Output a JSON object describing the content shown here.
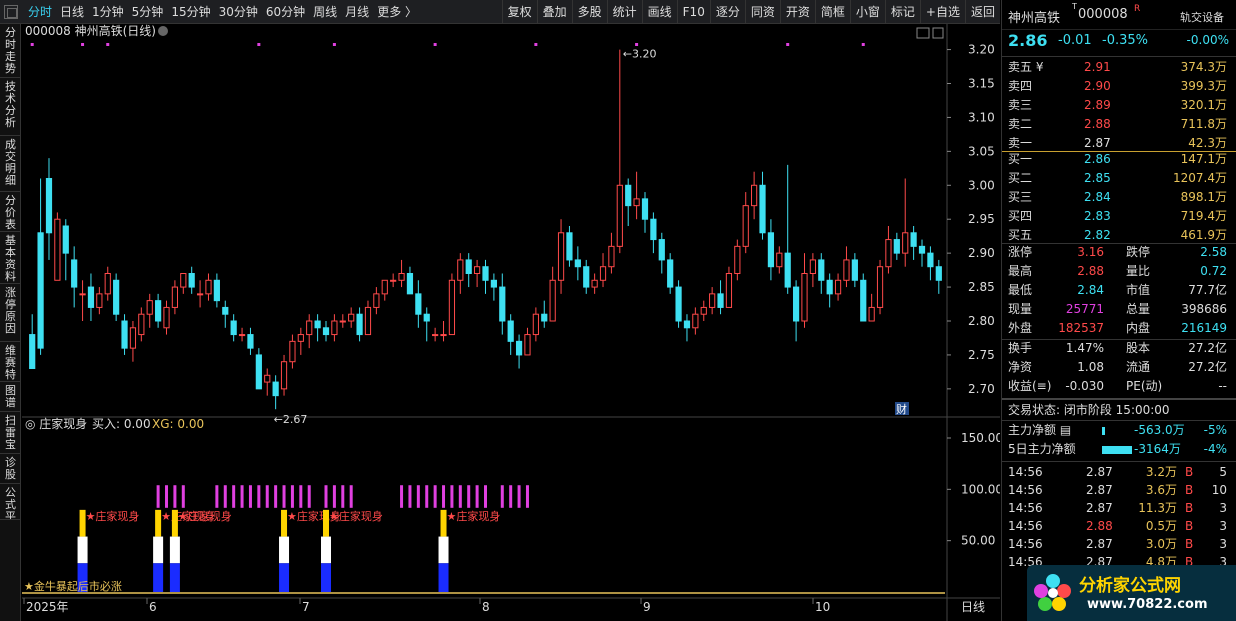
{
  "toolbar": {
    "tabs": [
      "分时",
      "日线",
      "1分钟",
      "5分钟",
      "15分钟",
      "30分钟",
      "60分钟",
      "周线",
      "月线",
      "更多 〉"
    ],
    "tools": [
      "复权",
      "叠加",
      "多股",
      "统计",
      "画线",
      "F10",
      "逐分",
      "同资",
      "开资",
      "简框",
      "小窗",
      "标记",
      "+自选",
      "返回"
    ]
  },
  "leftnav": [
    "分时走势",
    "技术分析",
    "成交明细",
    "分价表",
    "基本资料",
    "涨停原因",
    "维赛特",
    "图谱",
    "扫雷宝",
    "诊股",
    "公式平台"
  ],
  "chart": {
    "title": "000008 神州高铁(日线)",
    "price_axis": [
      "3.20",
      "3.15",
      "3.10",
      "3.05",
      "3.00",
      "2.95",
      "2.90",
      "2.85",
      "2.80",
      "2.75",
      "2.70"
    ],
    "high_label": "3.20",
    "low_label": "2.67",
    "cai_badge": "财",
    "indicator_title": "庄家现身",
    "indicator_buy": "买入: 0.00",
    "indicator_xg": "XG: 0.00",
    "ind_axis": [
      "150.00",
      "100.00",
      "50.00"
    ],
    "signal_label": "★庄家现身",
    "bottom_note": "★金牛暴起后市必涨",
    "x_labels": [
      "2025年",
      "6",
      "7",
      "8",
      "9",
      "10"
    ],
    "period": "日线"
  },
  "chart_data": {
    "type": "candlestick",
    "ylim": [
      2.66,
      3.22
    ],
    "candles": [
      [
        2.78,
        2.73,
        2.73,
        2.81
      ],
      [
        2.93,
        2.76,
        2.75,
        3.01
      ],
      [
        3.01,
        2.93,
        2.89,
        3.04
      ],
      [
        2.86,
        2.95,
        2.86,
        2.96
      ],
      [
        2.94,
        2.9,
        2.86,
        2.95
      ],
      [
        2.89,
        2.85,
        2.82,
        2.91
      ],
      [
        2.84,
        2.84,
        2.8,
        2.86
      ],
      [
        2.85,
        2.82,
        2.8,
        2.87
      ],
      [
        2.82,
        2.84,
        2.81,
        2.85
      ],
      [
        2.84,
        2.87,
        2.83,
        2.88
      ],
      [
        2.86,
        2.81,
        2.8,
        2.87
      ],
      [
        2.8,
        2.76,
        2.75,
        2.81
      ],
      [
        2.76,
        2.79,
        2.74,
        2.8
      ],
      [
        2.78,
        2.81,
        2.77,
        2.82
      ],
      [
        2.81,
        2.83,
        2.79,
        2.84
      ],
      [
        2.83,
        2.8,
        2.79,
        2.84
      ],
      [
        2.79,
        2.82,
        2.78,
        2.83
      ],
      [
        2.82,
        2.85,
        2.81,
        2.86
      ],
      [
        2.85,
        2.87,
        2.84,
        2.87
      ],
      [
        2.87,
        2.85,
        2.84,
        2.88
      ],
      [
        2.84,
        2.84,
        2.82,
        2.86
      ],
      [
        2.84,
        2.86,
        2.83,
        2.87
      ],
      [
        2.86,
        2.83,
        2.82,
        2.87
      ],
      [
        2.82,
        2.81,
        2.79,
        2.83
      ],
      [
        2.8,
        2.78,
        2.77,
        2.81
      ],
      [
        2.78,
        2.78,
        2.77,
        2.79
      ],
      [
        2.78,
        2.76,
        2.75,
        2.79
      ],
      [
        2.75,
        2.7,
        2.7,
        2.76
      ],
      [
        2.71,
        2.72,
        2.69,
        2.73
      ],
      [
        2.71,
        2.69,
        2.67,
        2.72
      ],
      [
        2.7,
        2.74,
        2.69,
        2.75
      ],
      [
        2.74,
        2.77,
        2.73,
        2.78
      ],
      [
        2.77,
        2.78,
        2.75,
        2.79
      ],
      [
        2.78,
        2.8,
        2.76,
        2.81
      ],
      [
        2.8,
        2.79,
        2.77,
        2.81
      ],
      [
        2.79,
        2.78,
        2.77,
        2.8
      ],
      [
        2.78,
        2.8,
        2.77,
        2.81
      ],
      [
        2.8,
        2.8,
        2.79,
        2.81
      ],
      [
        2.8,
        2.81,
        2.79,
        2.82
      ],
      [
        2.81,
        2.78,
        2.77,
        2.82
      ],
      [
        2.78,
        2.82,
        2.78,
        2.83
      ],
      [
        2.82,
        2.84,
        2.81,
        2.85
      ],
      [
        2.84,
        2.86,
        2.83,
        2.86
      ],
      [
        2.86,
        2.86,
        2.85,
        2.87
      ],
      [
        2.86,
        2.87,
        2.85,
        2.89
      ],
      [
        2.87,
        2.84,
        2.84,
        2.88
      ],
      [
        2.84,
        2.81,
        2.79,
        2.86
      ],
      [
        2.81,
        2.8,
        2.77,
        2.82
      ],
      [
        2.78,
        2.78,
        2.77,
        2.79
      ],
      [
        2.78,
        2.78,
        2.77,
        2.8
      ],
      [
        2.78,
        2.86,
        2.78,
        2.87
      ],
      [
        2.86,
        2.89,
        2.84,
        2.9
      ],
      [
        2.89,
        2.87,
        2.85,
        2.9
      ],
      [
        2.87,
        2.88,
        2.85,
        2.89
      ],
      [
        2.88,
        2.86,
        2.84,
        2.89
      ],
      [
        2.86,
        2.85,
        2.83,
        2.87
      ],
      [
        2.85,
        2.8,
        2.78,
        2.87
      ],
      [
        2.8,
        2.77,
        2.75,
        2.81
      ],
      [
        2.77,
        2.75,
        2.73,
        2.78
      ],
      [
        2.75,
        2.78,
        2.75,
        2.79
      ],
      [
        2.78,
        2.81,
        2.77,
        2.82
      ],
      [
        2.81,
        2.8,
        2.79,
        2.83
      ],
      [
        2.8,
        2.86,
        2.8,
        2.88
      ],
      [
        2.86,
        2.93,
        2.84,
        2.95
      ],
      [
        2.93,
        2.89,
        2.88,
        2.94
      ],
      [
        2.89,
        2.88,
        2.86,
        2.91
      ],
      [
        2.88,
        2.85,
        2.84,
        2.89
      ],
      [
        2.85,
        2.86,
        2.84,
        2.87
      ],
      [
        2.86,
        2.88,
        2.85,
        2.9
      ],
      [
        2.88,
        2.91,
        2.87,
        2.93
      ],
      [
        2.91,
        3.0,
        2.9,
        3.2
      ],
      [
        3.0,
        2.97,
        2.94,
        3.01
      ],
      [
        2.97,
        2.98,
        2.95,
        3.02
      ],
      [
        2.98,
        2.95,
        2.93,
        2.99
      ],
      [
        2.95,
        2.92,
        2.9,
        2.96
      ],
      [
        2.92,
        2.89,
        2.87,
        2.93
      ],
      [
        2.89,
        2.85,
        2.84,
        2.9
      ],
      [
        2.85,
        2.8,
        2.79,
        2.86
      ],
      [
        2.8,
        2.79,
        2.77,
        2.81
      ],
      [
        2.79,
        2.81,
        2.78,
        2.82
      ],
      [
        2.81,
        2.82,
        2.8,
        2.83
      ],
      [
        2.82,
        2.84,
        2.81,
        2.85
      ],
      [
        2.84,
        2.82,
        2.81,
        2.86
      ],
      [
        2.82,
        2.87,
        2.82,
        2.88
      ],
      [
        2.87,
        2.91,
        2.86,
        2.92
      ],
      [
        2.91,
        2.97,
        2.9,
        2.99
      ],
      [
        2.97,
        3.0,
        2.95,
        3.02
      ],
      [
        3.0,
        2.93,
        2.92,
        3.02
      ],
      [
        2.93,
        2.88,
        2.86,
        2.95
      ],
      [
        2.88,
        2.9,
        2.87,
        2.91
      ],
      [
        2.9,
        2.85,
        2.84,
        3.03
      ],
      [
        2.85,
        2.8,
        2.77,
        2.86
      ],
      [
        2.8,
        2.87,
        2.79,
        2.9
      ],
      [
        2.87,
        2.89,
        2.85,
        2.9
      ],
      [
        2.89,
        2.86,
        2.84,
        2.9
      ],
      [
        2.86,
        2.84,
        2.82,
        2.87
      ],
      [
        2.84,
        2.86,
        2.83,
        2.87
      ],
      [
        2.86,
        2.89,
        2.85,
        2.91
      ],
      [
        2.89,
        2.86,
        2.85,
        2.9
      ],
      [
        2.86,
        2.8,
        2.8,
        2.87
      ],
      [
        2.8,
        2.82,
        2.8,
        2.84
      ],
      [
        2.82,
        2.88,
        2.81,
        2.89
      ],
      [
        2.88,
        2.92,
        2.87,
        2.94
      ],
      [
        2.92,
        2.9,
        2.89,
        2.93
      ],
      [
        2.9,
        2.93,
        2.88,
        3.01
      ],
      [
        2.93,
        2.91,
        2.89,
        2.94
      ],
      [
        2.91,
        2.9,
        2.88,
        2.92
      ],
      [
        2.9,
        2.88,
        2.86,
        2.91
      ],
      [
        2.88,
        2.86,
        2.84,
        2.89
      ]
    ],
    "signals": [
      {
        "idx": 6
      },
      {
        "idx": 15
      },
      {
        "idx": 17
      },
      {
        "idx": 30
      },
      {
        "idx": 35
      },
      {
        "idx": 49
      }
    ],
    "pink_groups": [
      [
        15,
        18
      ],
      [
        22,
        33
      ],
      [
        35,
        38
      ],
      [
        44,
        54
      ],
      [
        56,
        59
      ]
    ]
  },
  "quote": {
    "name": "神州高铁",
    "code": "000008",
    "badge": "R",
    "price": "2.86",
    "change": "-0.01",
    "pct": "-0.35%",
    "link_label": "轨交设备",
    "link_pct": "-0.00%",
    "asks": [
      [
        "卖五 ¥",
        "2.91",
        "374.3万"
      ],
      [
        "卖四",
        "2.90",
        "399.3万"
      ],
      [
        "卖三",
        "2.89",
        "320.1万"
      ],
      [
        "卖二",
        "2.88",
        "711.8万"
      ],
      [
        "卖一",
        "2.87",
        "42.3万"
      ]
    ],
    "bids": [
      [
        "买一",
        "2.86",
        "147.1万"
      ],
      [
        "买二",
        "2.85",
        "1207.4万"
      ],
      [
        "买三",
        "2.84",
        "898.1万"
      ],
      [
        "买四",
        "2.83",
        "719.4万"
      ],
      [
        "买五",
        "2.82",
        "461.9万"
      ]
    ],
    "stats": [
      [
        "涨停",
        "3.16",
        "跌停",
        "2.58"
      ],
      [
        "最高",
        "2.88",
        "量比",
        "0.72"
      ],
      [
        "最低",
        "2.84",
        "市值",
        "77.7亿"
      ],
      [
        "现量",
        "25771",
        "总量",
        "398686"
      ],
      [
        "外盘",
        "182537",
        "内盘",
        "216149"
      ]
    ],
    "stats2": [
      [
        "换手",
        "1.47%",
        "股本",
        "27.2亿"
      ],
      [
        "净资",
        "1.08",
        "流通",
        "27.2亿"
      ],
      [
        "收益(≡)",
        "-0.030",
        "PE(动)",
        "--"
      ]
    ],
    "trade_status": "交易状态: 闭市阶段 15:00:00",
    "main_flow_label": "主力净额",
    "main_flow_val": "-563.0万",
    "main_flow_pct": "-5%",
    "flow5_label": "5日主力净额",
    "flow5_val": "-3164万",
    "flow5_pct": "-4%",
    "ticks": [
      [
        "14:56",
        "2.87",
        "3.2万",
        "B",
        "5"
      ],
      [
        "14:56",
        "2.87",
        "3.6万",
        "B",
        "10"
      ],
      [
        "14:56",
        "2.87",
        "11.3万",
        "B",
        "3"
      ],
      [
        "14:56",
        "2.88",
        "0.5万",
        "B",
        "3"
      ],
      [
        "14:56",
        "2.87",
        "3.0万",
        "B",
        "3"
      ],
      [
        "14:56",
        "2.87",
        "4.8万",
        "B",
        "3"
      ]
    ],
    "logo_text": "分析家公式网",
    "logo_url": "www.70822.com"
  },
  "colors": {
    "up": "#ff4a4a",
    "down": "#3ee0f2",
    "pink": "#e040e0",
    "yellow": "#ffd400",
    "blue": "#1a2cff"
  }
}
